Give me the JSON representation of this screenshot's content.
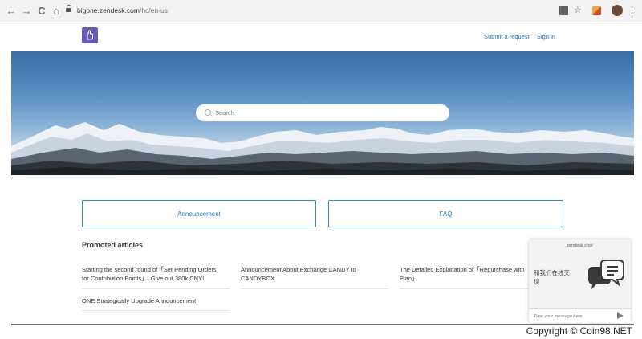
{
  "browser": {
    "url_domain": "bigone.zendesk.com",
    "url_path": "/hc/en-us",
    "back_glyph": "←",
    "forward_glyph": "→",
    "reload_glyph": "C",
    "home_glyph": "⌂",
    "star_glyph": "☆",
    "menu_glyph": "⋮"
  },
  "header": {
    "submit_request_label": "Submit a request",
    "sign_in_label": "Sign in",
    "logo_color": "#6a5ab3"
  },
  "hero": {
    "search_placeholder": "Search"
  },
  "categories": [
    {
      "label": "Announcement"
    },
    {
      "label": "FAQ"
    }
  ],
  "promoted": {
    "title": "Promoted articles",
    "articles": [
      {
        "line1": "Starting the second round of「Set Pending Orders",
        "line2": "for Contribution Points」, Give out 380k CNY!"
      },
      {
        "line1": "Announcement About Exchange CANDY to",
        "line2": "CANDYBOX"
      },
      {
        "line1": "The Detailed Explanation of「Repurchase with",
        "line2": "Plan」"
      },
      {
        "line1": "ONE Strategically Upgrade Announcement",
        "line2": ""
      }
    ]
  },
  "chat": {
    "header": "zendesk chat",
    "greeting_line1": "和我们在线交",
    "greeting_line2": "谈",
    "input_placeholder": "Type your message here"
  },
  "footer": {
    "copyright": "Copyright © Coin98.NET"
  },
  "colors": {
    "link": "#1f73b7",
    "block_border": "#2f8fb5"
  }
}
